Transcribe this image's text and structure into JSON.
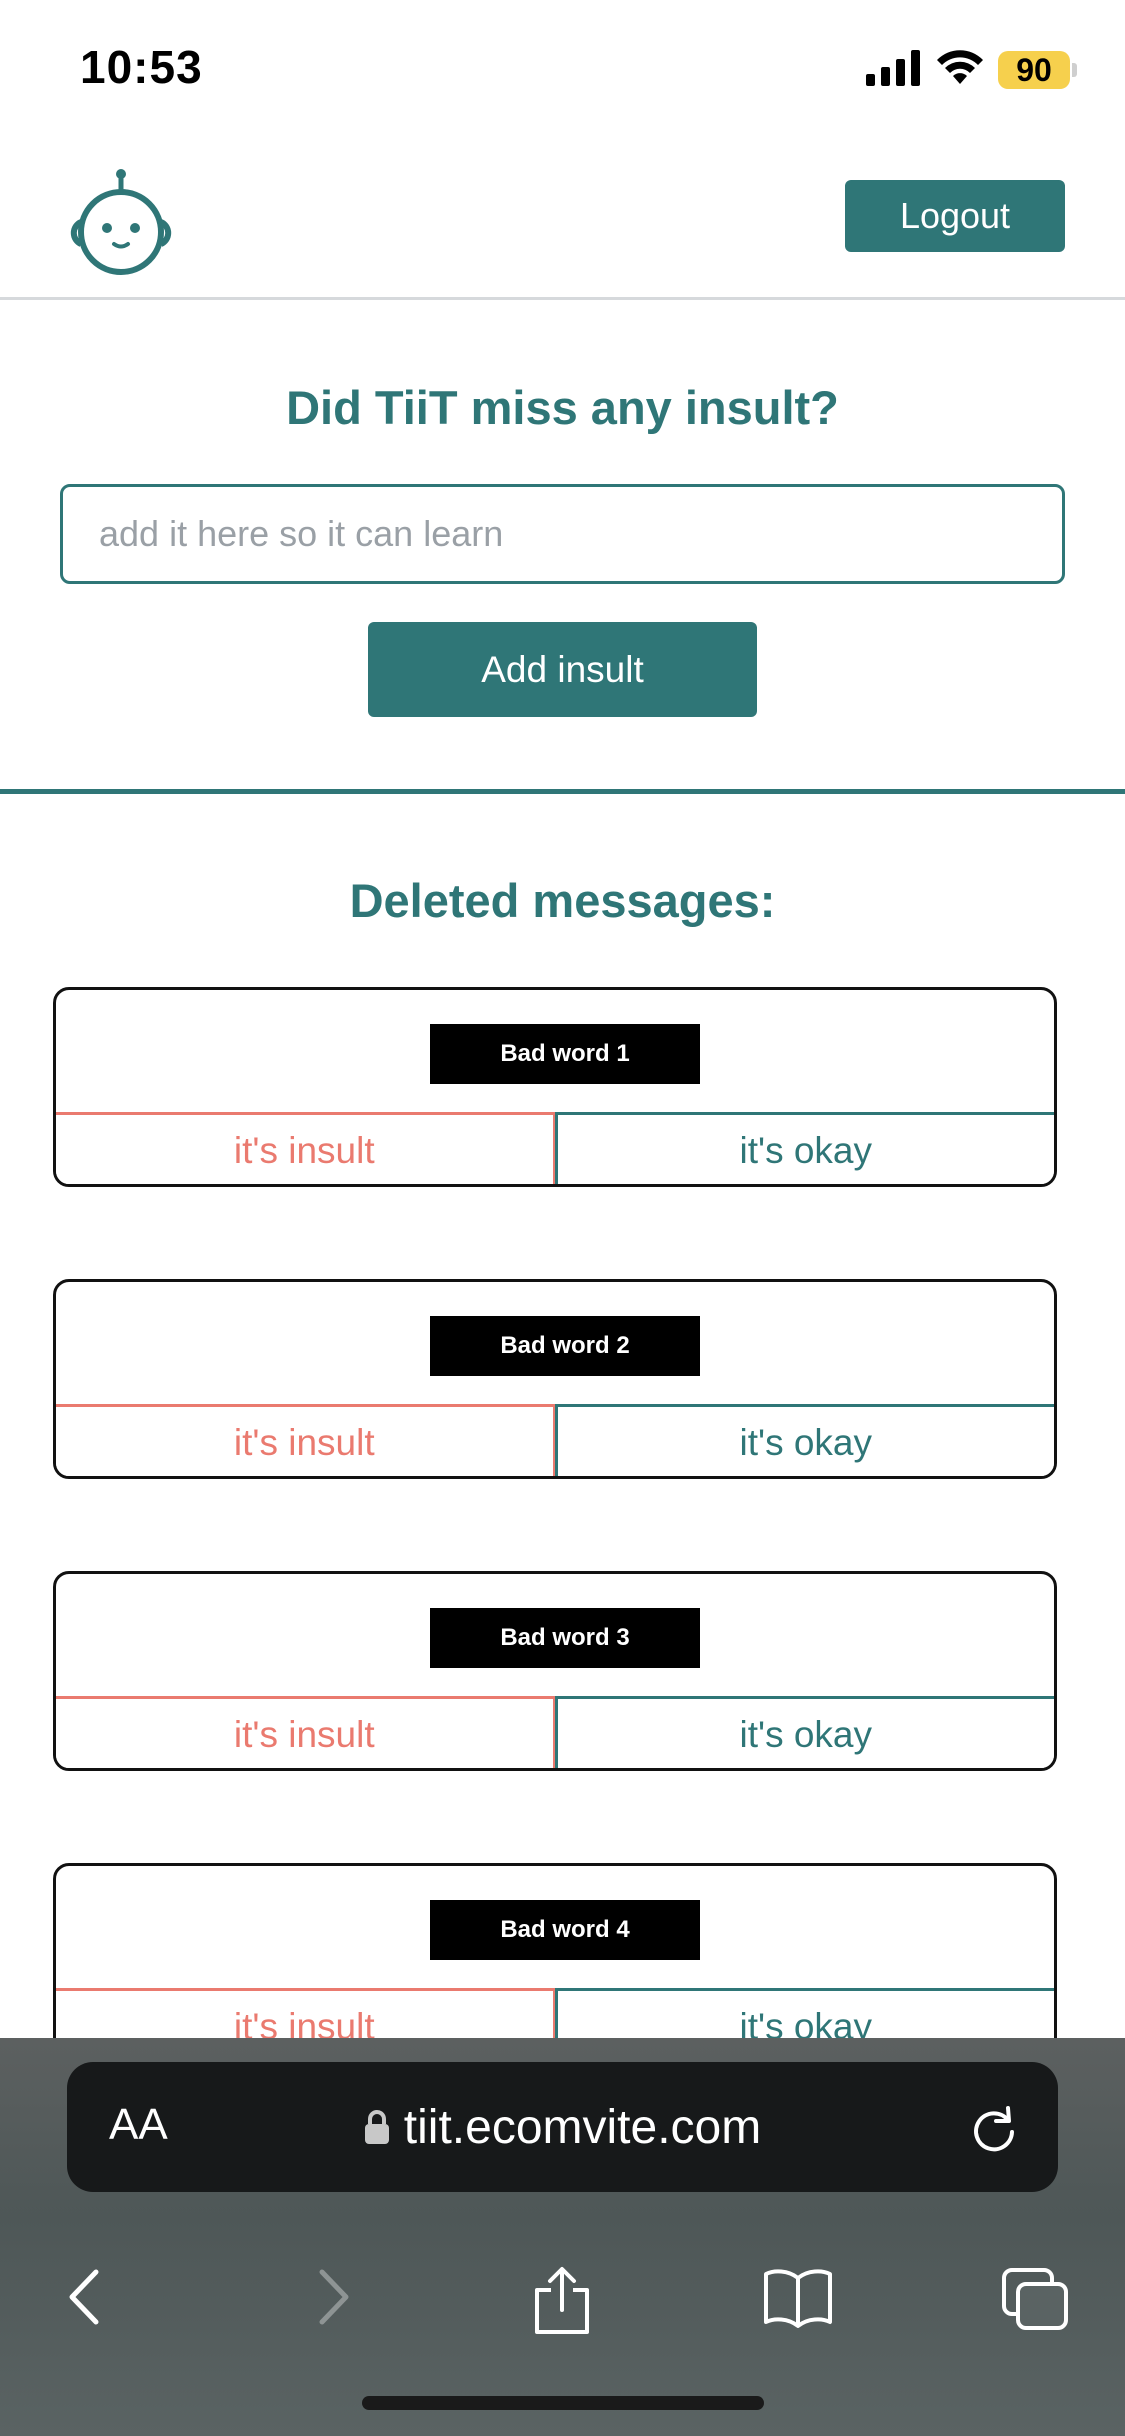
{
  "status_bar": {
    "time": "10:53",
    "battery_level": "90"
  },
  "header": {
    "logout_label": "Logout"
  },
  "insult_form": {
    "title": "Did TiiT miss any insult?",
    "input_placeholder": "add it here so it can learn",
    "input_value": "",
    "submit_label": "Add insult"
  },
  "deleted": {
    "title": "Deleted messages:",
    "items": [
      {
        "word": "Bad word 1",
        "insult_label": "it's insult",
        "okay_label": "it's okay"
      },
      {
        "word": "Bad word 2",
        "insult_label": "it's insult",
        "okay_label": "it's okay"
      },
      {
        "word": "Bad word 3",
        "insult_label": "it's insult",
        "okay_label": "it's okay"
      },
      {
        "word": "Bad word 4",
        "insult_label": "it's insult",
        "okay_label": "it's okay"
      }
    ]
  },
  "browser": {
    "text_size_label": "AA",
    "url": "tiit.ecomvite.com"
  },
  "colors": {
    "primary": "#2f7677",
    "insult": "#ea7a6f",
    "battery": "#f6d04d"
  }
}
